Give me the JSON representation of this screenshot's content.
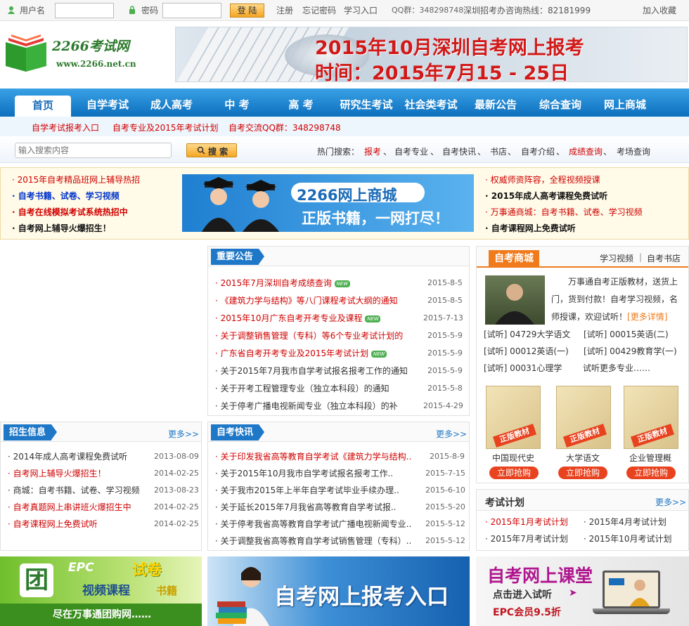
{
  "topbar": {
    "username_label": "用户名",
    "password_label": "密码",
    "login_button": "登 陆",
    "register": "注册",
    "forgot": "忘记密码",
    "study_entry": "学习入口",
    "qq_group": "QQ群：348298748",
    "hotline": "深圳招考办咨询热线：82181999",
    "favorite": "加入收藏"
  },
  "logo": {
    "name": "2266考试网",
    "url": "www.2266.net.cn"
  },
  "banner": {
    "line1": "2015年10月深圳自考网上报考",
    "line2": "时间：2015年7月15 - 25日"
  },
  "nav": {
    "items": [
      "首页",
      "自学考试",
      "成人高考",
      "中 考",
      "高 考",
      "研究生考试",
      "社会类考试",
      "最新公告",
      "综合查询",
      "网上商城"
    ]
  },
  "subnav": {
    "items": [
      "自学考试报考入口",
      "自考专业及2015年考试计划",
      "自考交流QQ群：348298748"
    ]
  },
  "search": {
    "placeholder": "输入搜索内容",
    "button": "搜 索",
    "hot_label": "热门搜索：",
    "hot_items": [
      "报考",
      "自考专业",
      "自考快讯",
      "书店",
      "自考介绍",
      "成绩查询",
      "考场查询"
    ]
  },
  "promo": {
    "left_links": [
      "2015年自考精品班网上辅导热招",
      "自考书籍、试卷、学习视频",
      "自考在线模拟考试系统热招中",
      "自考网上辅导火爆招生！"
    ],
    "center_title": "2266网上商城",
    "center_sub": "正版书籍，一网打尽！",
    "right_links": [
      "权威师资阵容，全程视频授课",
      "2015年成人高考课程免费试听",
      "万事通商城：自考书籍、试卷、学习视频",
      "自考课程网上免费试听"
    ]
  },
  "notice": {
    "title": "重要公告",
    "items": [
      {
        "text": "2015年7月深圳自考成绩查询",
        "date": "2015-8-5",
        "new": "NEW",
        "red": true
      },
      {
        "text": "《建筑力学与结构》等八门课程考试大纲的通知",
        "date": "2015-8-5",
        "red": true
      },
      {
        "text": "2015年10月广东自考开考专业及课程",
        "date": "2015-7-13",
        "new": "NEW",
        "red": true
      },
      {
        "text": "关于调整销售管理（专科）等6个专业考试计划的",
        "date": "2015-5-9",
        "red": true
      },
      {
        "text": "广东省自考开考专业及2015年考试计划",
        "date": "2015-5-9",
        "new": "NEW",
        "red": true
      },
      {
        "text": "关于2015年7月我市自学考试报名报考工作的通知",
        "date": "2015-5-9",
        "red": false
      },
      {
        "text": "关于开考工程管理专业（独立本科段）的通知",
        "date": "2015-5-8",
        "red": false
      },
      {
        "text": "关于停考广播电视新闻专业（独立本科段）的补",
        "date": "2015-4-29",
        "red": false
      }
    ]
  },
  "zhaosheng": {
    "title": "招生信息",
    "more": "更多>>",
    "items": [
      {
        "text": "2014年成人高考课程免费试听",
        "date": "2013-08-09",
        "red": false
      },
      {
        "text": "自考网上辅导火爆招生！",
        "date": "2014-02-25",
        "red": true
      },
      {
        "text": "商城：自考书籍、试卷、学习视频",
        "date": "2013-08-23",
        "red": false
      },
      {
        "text": "自考真题网上串讲班火爆招生中",
        "date": "2014-02-25",
        "red": true
      },
      {
        "text": "自考课程网上免费试听",
        "date": "2014-02-25",
        "red": true
      }
    ]
  },
  "kuaixun": {
    "title": "自考快讯",
    "more": "更多>>",
    "items": [
      {
        "text": "关于印发我省高等教育自学考试《建筑力学与结构..",
        "date": "2015-8-9",
        "red": true
      },
      {
        "text": "关于2015年10月我市自学考试报名报考工作..",
        "date": "2015-7-15",
        "red": false
      },
      {
        "text": "关于我市2015年上半年自学考试毕业手续办理..",
        "date": "2015-6-10",
        "red": false
      },
      {
        "text": "关于延长2015年7月我省高等教育自学考试报..",
        "date": "2015-5-20",
        "red": false
      },
      {
        "text": "关于停考我省高等教育自学考试广播电视新闻专业..",
        "date": "2015-5-12",
        "red": false
      },
      {
        "text": "关于调整我省高等教育自学考试销售管理（专科）..",
        "date": "2015-5-12",
        "red": false
      }
    ]
  },
  "mall": {
    "title": "自考商城",
    "tab1": "学习视频",
    "sep": "|",
    "tab2": "自考书店",
    "intro": "万事通自考正版教材，送货上门，货到付款！自考学习视频，名师授课，欢迎试听！",
    "intro_more": "[更多详情]",
    "audition": [
      "[试听] 04729大学语文",
      "[试听] 00015英语(二)",
      "[试听] 00012英语(一)",
      "[试听] 00429教育学(一)",
      "[试听] 00031心理学",
      "试听更多专业……"
    ],
    "books": [
      {
        "name": "中国现代史",
        "stamp": "正版教材",
        "buy": "立即抢购"
      },
      {
        "name": "大学语文",
        "stamp": "正版教材",
        "buy": "立即抢购"
      },
      {
        "name": "企业管理概",
        "stamp": "正版教材",
        "buy": "立即抢购"
      }
    ]
  },
  "plan": {
    "title": "考试计划",
    "more": "更多>>",
    "items": [
      "2015年1月考试计划",
      "2015年4月考试计划",
      "2015年7月考试计划",
      "2015年10月考试计划"
    ]
  },
  "bottom_banners": {
    "b1_tuan": "团",
    "b1_epc": "EPC",
    "b1_shijuan": "试卷",
    "b1_video": "视频课程",
    "b1_book": "书籍",
    "b1_sub": "尽在万事通团购网……",
    "b2_text": "自考网上报考入口",
    "b3_title": "自考网上课堂",
    "b3_sub": "点击进入试听",
    "b3_vip": "EPC会员9.5折"
  }
}
